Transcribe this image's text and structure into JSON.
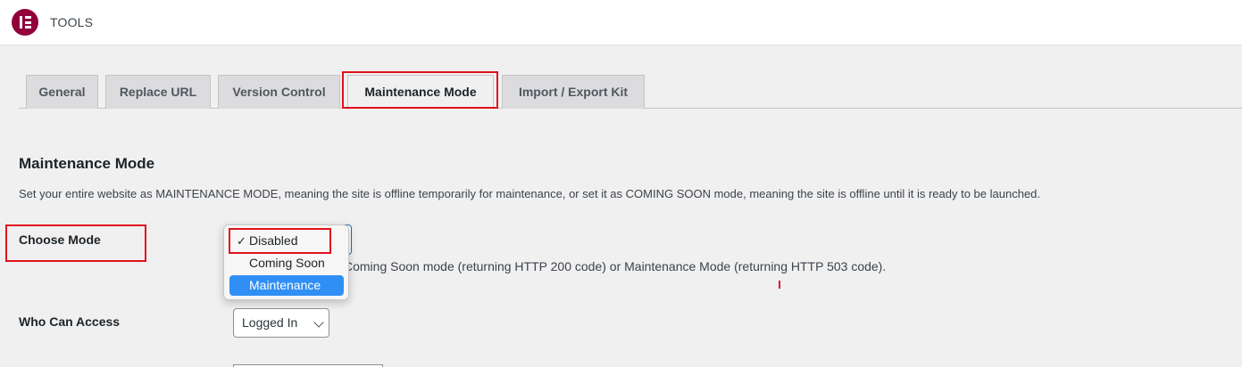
{
  "header": {
    "title": "TOOLS",
    "logo_icon": "elementor-logo-icon",
    "logo_color": "#92003b"
  },
  "tabs": [
    {
      "label": "General",
      "active": false
    },
    {
      "label": "Replace URL",
      "active": false
    },
    {
      "label": "Version Control",
      "active": false
    },
    {
      "label": "Maintenance Mode",
      "active": true
    },
    {
      "label": "Import / Export Kit",
      "active": false
    }
  ],
  "section": {
    "title": "Maintenance Mode",
    "description": "Set your entire website as MAINTENANCE MODE, meaning the site is offline temporarily for maintenance, or set it as COMING SOON mode, meaning the site is offline until it is ready to be launched."
  },
  "choose_mode": {
    "label": "Choose Mode",
    "description": "Coming Soon mode (returning HTTP 200 code) or Maintenance Mode (returning HTTP 503 code).",
    "options": [
      {
        "label": "Disabled",
        "checked": true,
        "check": "✓"
      },
      {
        "label": "Coming Soon",
        "checked": false
      },
      {
        "label": "Maintenance",
        "highlighted": true
      }
    ],
    "highlight_color": "#2f8ff5"
  },
  "who_can_access": {
    "label": "Who Can Access",
    "value": "Logged In"
  },
  "annotation_color": "#e0111b"
}
